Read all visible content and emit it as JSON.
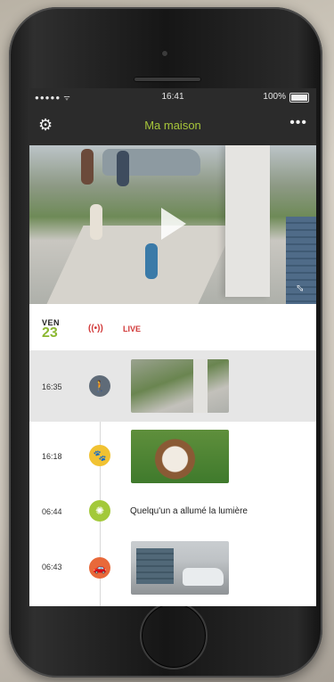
{
  "statusbar": {
    "signal": "●●●●● ᯤ",
    "time": "16:41",
    "battery": "100%"
  },
  "navbar": {
    "title": "Ma maison",
    "settings_icon": "gear-icon",
    "more_icon": "more-icon",
    "more_glyph": "•••"
  },
  "video": {
    "state": "paused"
  },
  "timeline": {
    "day_label": "VEN",
    "day_number": "23",
    "live_icon": "((•))",
    "live_label": "LIVE",
    "events": [
      {
        "time": "16:35",
        "icon": "person-walking-icon",
        "glyph": "🚶",
        "color": "#5f6b78",
        "type": "thumbnail"
      },
      {
        "time": "16:18",
        "icon": "paw-icon",
        "glyph": "🐾",
        "color": "#f1c232",
        "type": "thumbnail"
      },
      {
        "time": "06:44",
        "icon": "light-icon",
        "glyph": "✺",
        "color": "#a3c93a",
        "type": "text",
        "text": "Quelqu'un a allumé la lumière"
      },
      {
        "time": "06:43",
        "icon": "car-icon",
        "glyph": "🚗",
        "color": "#e8693a",
        "type": "thumbnail"
      }
    ]
  }
}
